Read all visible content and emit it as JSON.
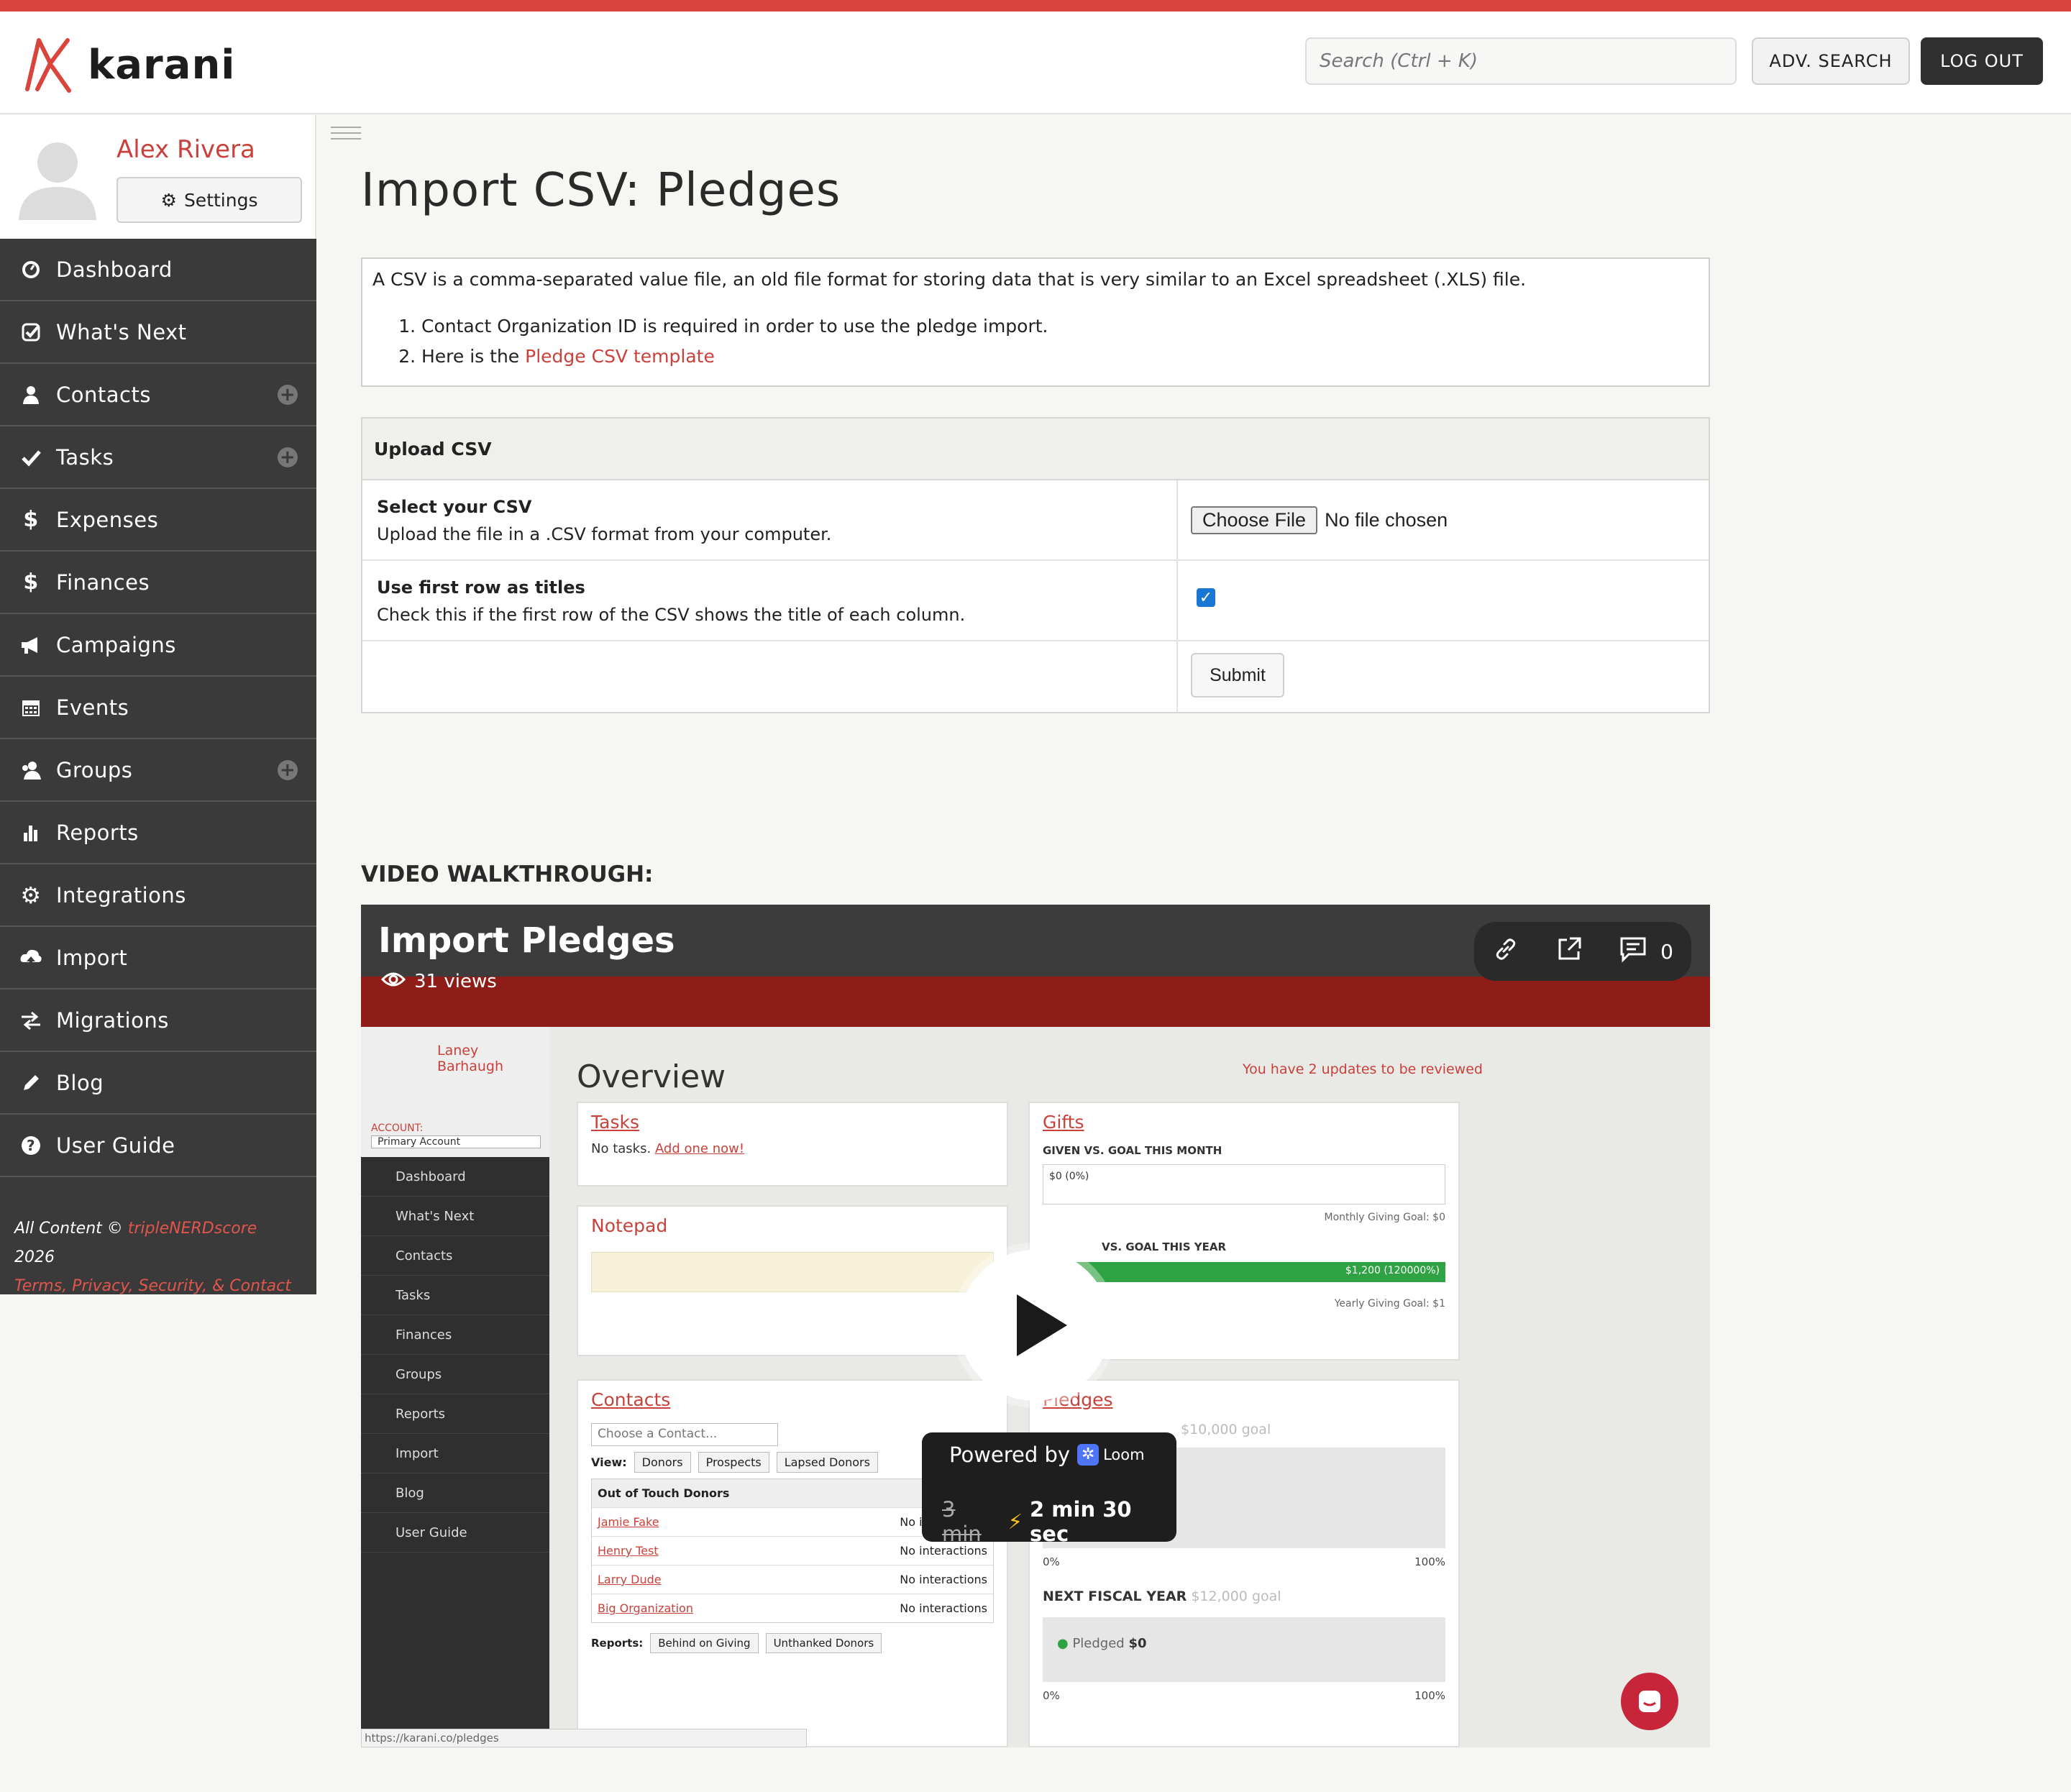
{
  "brand": {
    "name": "karani",
    "accent": "#d9453c"
  },
  "header": {
    "search_placeholder": "Search (Ctrl + K)",
    "adv_search_label": "ADV. SEARCH",
    "logout_label": "LOG OUT"
  },
  "profile": {
    "name": "Alex Rivera",
    "settings_label": "Settings"
  },
  "sidebar": {
    "items": [
      {
        "label": "Dashboard",
        "icon": "dashboard-icon"
      },
      {
        "label": "What's Next",
        "icon": "checklist-icon"
      },
      {
        "label": "Contacts",
        "icon": "user-icon",
        "add": true
      },
      {
        "label": "Tasks",
        "icon": "check-icon",
        "add": true
      },
      {
        "label": "Expenses",
        "icon": "dollar-icon"
      },
      {
        "label": "Finances",
        "icon": "dollar-icon"
      },
      {
        "label": "Campaigns",
        "icon": "megaphone-icon"
      },
      {
        "label": "Events",
        "icon": "calendar-icon"
      },
      {
        "label": "Groups",
        "icon": "group-icon",
        "add": true
      },
      {
        "label": "Reports",
        "icon": "bar-chart-icon"
      },
      {
        "label": "Integrations",
        "icon": "gear-icon"
      },
      {
        "label": "Import",
        "icon": "cloud-upload-icon"
      },
      {
        "label": "Migrations",
        "icon": "swap-arrows-icon"
      },
      {
        "label": "Blog",
        "icon": "pencil-icon"
      },
      {
        "label": "User Guide",
        "icon": "help-icon"
      }
    ],
    "footer": {
      "prefix": "All Content ©",
      "company": "tripleNERDscore",
      "year": "2026",
      "links": "Terms, Privacy, Security, & Contact"
    }
  },
  "page": {
    "title": "Import CSV: Pledges"
  },
  "info": {
    "intro": "A CSV is a comma-separated value file, an old file format for storing data that is very similar to an Excel spreadsheet (.XLS) file.",
    "item1": "Contact Organization ID is required in order to use the pledge import.",
    "item2_prefix": "Here is the",
    "item2_link": "Pledge CSV template"
  },
  "upload": {
    "heading": "Upload CSV",
    "select_title": "Select your CSV",
    "select_desc": "Upload the file in a .CSV format from your computer.",
    "choose_label": "Choose File",
    "no_file": "No file chosen",
    "first_row_title": "Use first row as titles",
    "first_row_desc": "Check this if the first row of the CSV shows the title of each column.",
    "first_row_checked": true,
    "submit_label": "Submit"
  },
  "video": {
    "heading": "VIDEO WALKTHROUGH:",
    "title": "Import Pledges",
    "views": "31 views",
    "comments": "0",
    "powered_by": "Powered by",
    "loom": "Loom",
    "old_time": "3 min",
    "new_time": "2 min 30 sec",
    "inner": {
      "overview": "Overview",
      "updates": "You have 2 updates to be reviewed",
      "user": "Laney Barhaugh",
      "account_label": "ACCOUNT:",
      "account": "Primary Account",
      "nav": [
        "Dashboard",
        "What's Next",
        "Contacts",
        "Tasks",
        "Finances",
        "Groups",
        "Reports",
        "Import",
        "Blog",
        "User Guide"
      ],
      "tasks": "Tasks",
      "no_tasks": "No tasks.",
      "add_one": "Add one now!",
      "notepad": "Notepad",
      "contacts": "Contacts",
      "gifts": "Gifts",
      "pledges": "Pledges",
      "given_month": "GIVEN VS. GOAL THIS MONTH",
      "given_year": "VS. GOAL THIS YEAR",
      "year_value": "$1,200 (120000%)",
      "month_value": "$0 (0%)",
      "monthly_goal": "Monthly Giving Goal: $0",
      "yearly_goal": "Yearly Giving Goal: $1",
      "choose_contact": "Choose a Contact...",
      "view": "View:",
      "donors": "Donors",
      "prospects": "Prospects",
      "lapsed": "Lapsed Donors",
      "out_of_touch": "Out of Touch Donors",
      "rows": [
        {
          "name": "Jamie Fake",
          "status": "No interactions"
        },
        {
          "name": "Henry Test",
          "status": "No interactions"
        },
        {
          "name": "Larry Dude",
          "status": "No interactions"
        },
        {
          "name": "Big Organization",
          "status": "No interactions"
        }
      ],
      "reports": "Reports:",
      "behind": "Behind on Giving",
      "unthanked": "Unthanked Donors",
      "goal_10k": "$10,000 goal",
      "next_fy": "NEXT FISCAL YEAR",
      "goal_12k": "$12,000 goal",
      "pledged": "Pledged",
      "pledged_val": "$0",
      "pct0": "0%",
      "pct100": "100%",
      "url": "https://karani.co/pledges"
    }
  }
}
